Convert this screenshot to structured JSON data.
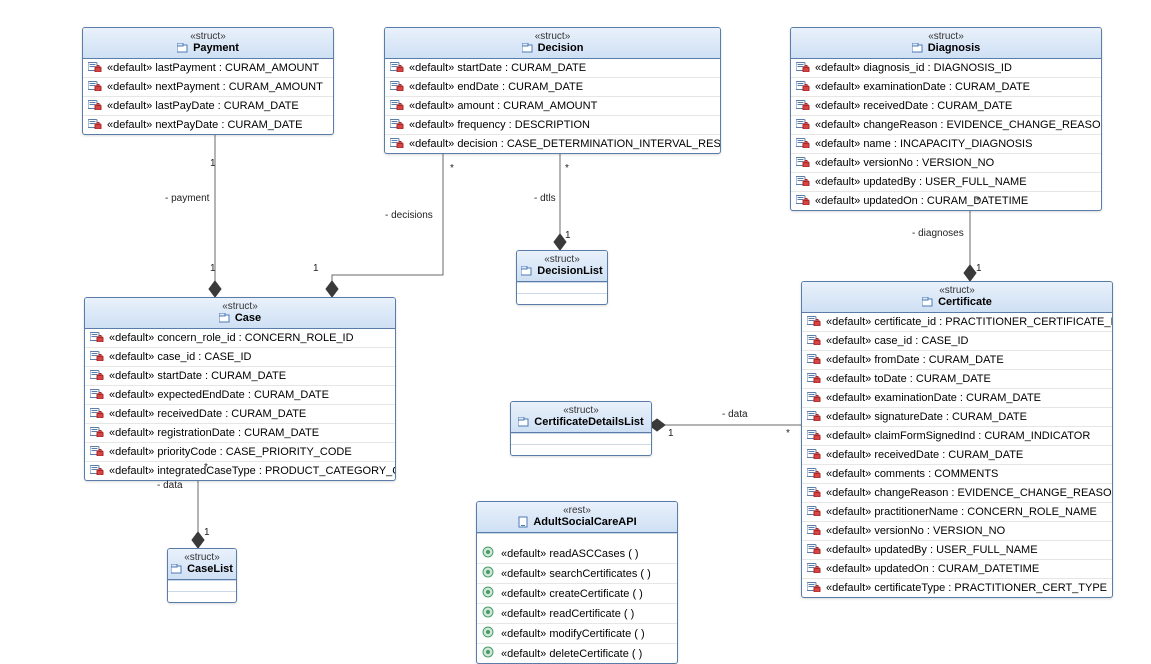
{
  "stereotypes": {
    "struct": "«struct»",
    "rest": "«rest»",
    "def": "«default»"
  },
  "classes": {
    "payment": {
      "name": "Payment",
      "attrs": [
        "lastPayment : CURAM_AMOUNT",
        "nextPayment : CURAM_AMOUNT",
        "lastPayDate : CURAM_DATE",
        "nextPayDate : CURAM_DATE"
      ]
    },
    "decision": {
      "name": "Decision",
      "attrs": [
        "startDate : CURAM_DATE",
        "endDate : CURAM_DATE",
        "amount : CURAM_AMOUNT",
        "frequency : DESCRIPTION",
        "decision : CASE_DETERMINATION_INTERVAL_RESULT"
      ]
    },
    "diagnosis": {
      "name": "Diagnosis",
      "attrs": [
        "diagnosis_id : DIAGNOSIS_ID",
        "examinationDate : CURAM_DATE",
        "receivedDate : CURAM_DATE",
        "changeReason : EVIDENCE_CHANGE_REASON",
        "name : INCAPACITY_DIAGNOSIS",
        "versionNo : VERSION_NO",
        "updatedBy : USER_FULL_NAME",
        "updatedOn : CURAM_DATETIME"
      ]
    },
    "case": {
      "name": "Case",
      "attrs": [
        "concern_role_id : CONCERN_ROLE_ID",
        "case_id : CASE_ID",
        "startDate : CURAM_DATE",
        "expectedEndDate : CURAM_DATE",
        "receivedDate : CURAM_DATE",
        "registrationDate : CURAM_DATE",
        "priorityCode : CASE_PRIORITY_CODE",
        "integratedCaseType : PRODUCT_CATEGORY_CODE"
      ]
    },
    "decisionList": {
      "name": "DecisionList",
      "attrs": []
    },
    "certDetailsList": {
      "name": "CertificateDetailsList",
      "attrs": []
    },
    "caseList": {
      "name": "CaseList",
      "attrs": []
    },
    "certificate": {
      "name": "Certificate",
      "attrs": [
        "certificate_id : PRACTITIONER_CERTIFICATE_ID",
        "case_id : CASE_ID",
        "fromDate : CURAM_DATE",
        "toDate : CURAM_DATE",
        "examinationDate : CURAM_DATE",
        "signatureDate : CURAM_DATE",
        "claimFormSignedInd : CURAM_INDICATOR",
        "receivedDate : CURAM_DATE",
        "comments : COMMENTS",
        "changeReason : EVIDENCE_CHANGE_REASON",
        "practitionerName : CONCERN_ROLE_NAME",
        "versionNo : VERSION_NO",
        "updatedBy : USER_FULL_NAME",
        "updatedOn : CURAM_DATETIME",
        "certificateType : PRACTITIONER_CERT_TYPE"
      ]
    },
    "api": {
      "name": "AdultSocialCareAPI",
      "ops": [
        "readASCCases ( )",
        "searchCertificates ( )",
        "createCertificate ( )",
        "readCertificate ( )",
        "modifyCertificate ( )",
        "deleteCertificate ( )"
      ]
    }
  },
  "labels": {
    "payment_role": "- payment",
    "decisions_role": "- decisions",
    "dtls_role": "- dtls",
    "diagnoses_role": "- diagnoses",
    "data_role": "- data",
    "case_data_role": "- data",
    "one": "1",
    "star": "*"
  }
}
